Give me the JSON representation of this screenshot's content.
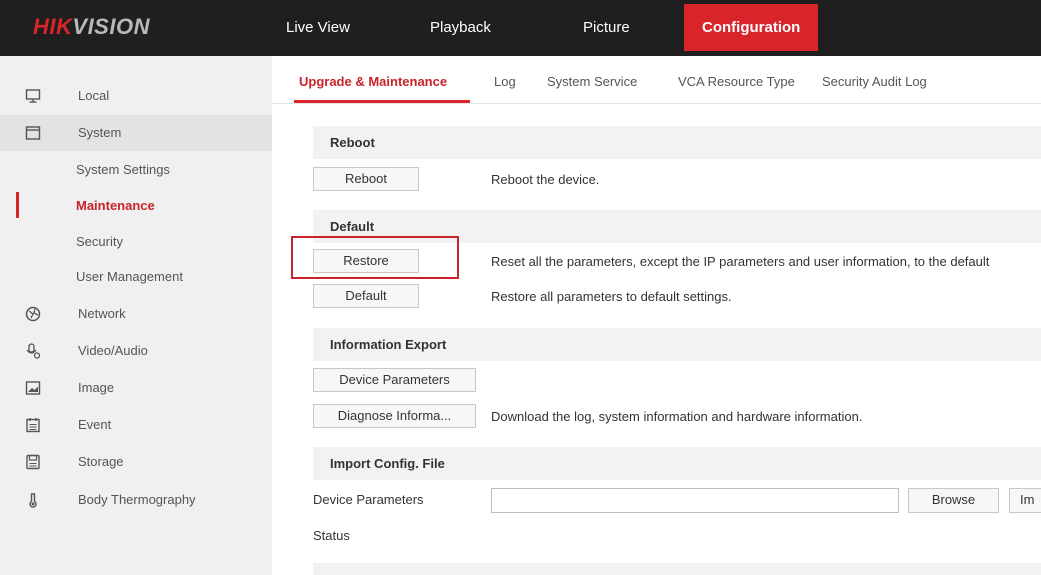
{
  "header": {
    "logo_part1": "HIK",
    "logo_part2": "VISION",
    "nav": [
      "Live View",
      "Playback",
      "Picture",
      "Configuration"
    ]
  },
  "sidebar": {
    "items": [
      {
        "label": "Local",
        "icon": "monitor-icon"
      },
      {
        "label": "System",
        "icon": "window-icon"
      },
      {
        "label": "System Settings"
      },
      {
        "label": "Maintenance"
      },
      {
        "label": "Security"
      },
      {
        "label": "User Management"
      },
      {
        "label": "Network",
        "icon": "globe-icon"
      },
      {
        "label": "Video/Audio",
        "icon": "mic-icon"
      },
      {
        "label": "Image",
        "icon": "image-icon"
      },
      {
        "label": "Event",
        "icon": "calendar-icon"
      },
      {
        "label": "Storage",
        "icon": "disk-icon"
      },
      {
        "label": "Body Thermography",
        "icon": "thermometer-icon"
      }
    ]
  },
  "tabs": [
    "Upgrade & Maintenance",
    "Log",
    "System Service",
    "VCA Resource Type",
    "Security Audit Log"
  ],
  "content": {
    "reboot": {
      "title": "Reboot",
      "button": "Reboot",
      "desc": "Reboot the device."
    },
    "default": {
      "title": "Default",
      "restore_button": "Restore",
      "restore_desc": "Reset all the parameters, except the IP parameters and user information, to the default",
      "default_button": "Default",
      "default_desc": "Restore all parameters to default settings."
    },
    "export": {
      "title": "Information Export",
      "device_params_button": "Device Parameters",
      "diagnose_button": "Diagnose Informa...",
      "diagnose_desc": "Download the log, system information and hardware information."
    },
    "import": {
      "title": "Import Config. File",
      "field_label": "Device Parameters",
      "field_value": "",
      "browse_button": "Browse",
      "import_button": "Im",
      "status_label": "Status"
    }
  },
  "colors": {
    "accent": "#d9242a",
    "topbar": "#1f1f1f",
    "sidebar": "#f0f0f0"
  }
}
